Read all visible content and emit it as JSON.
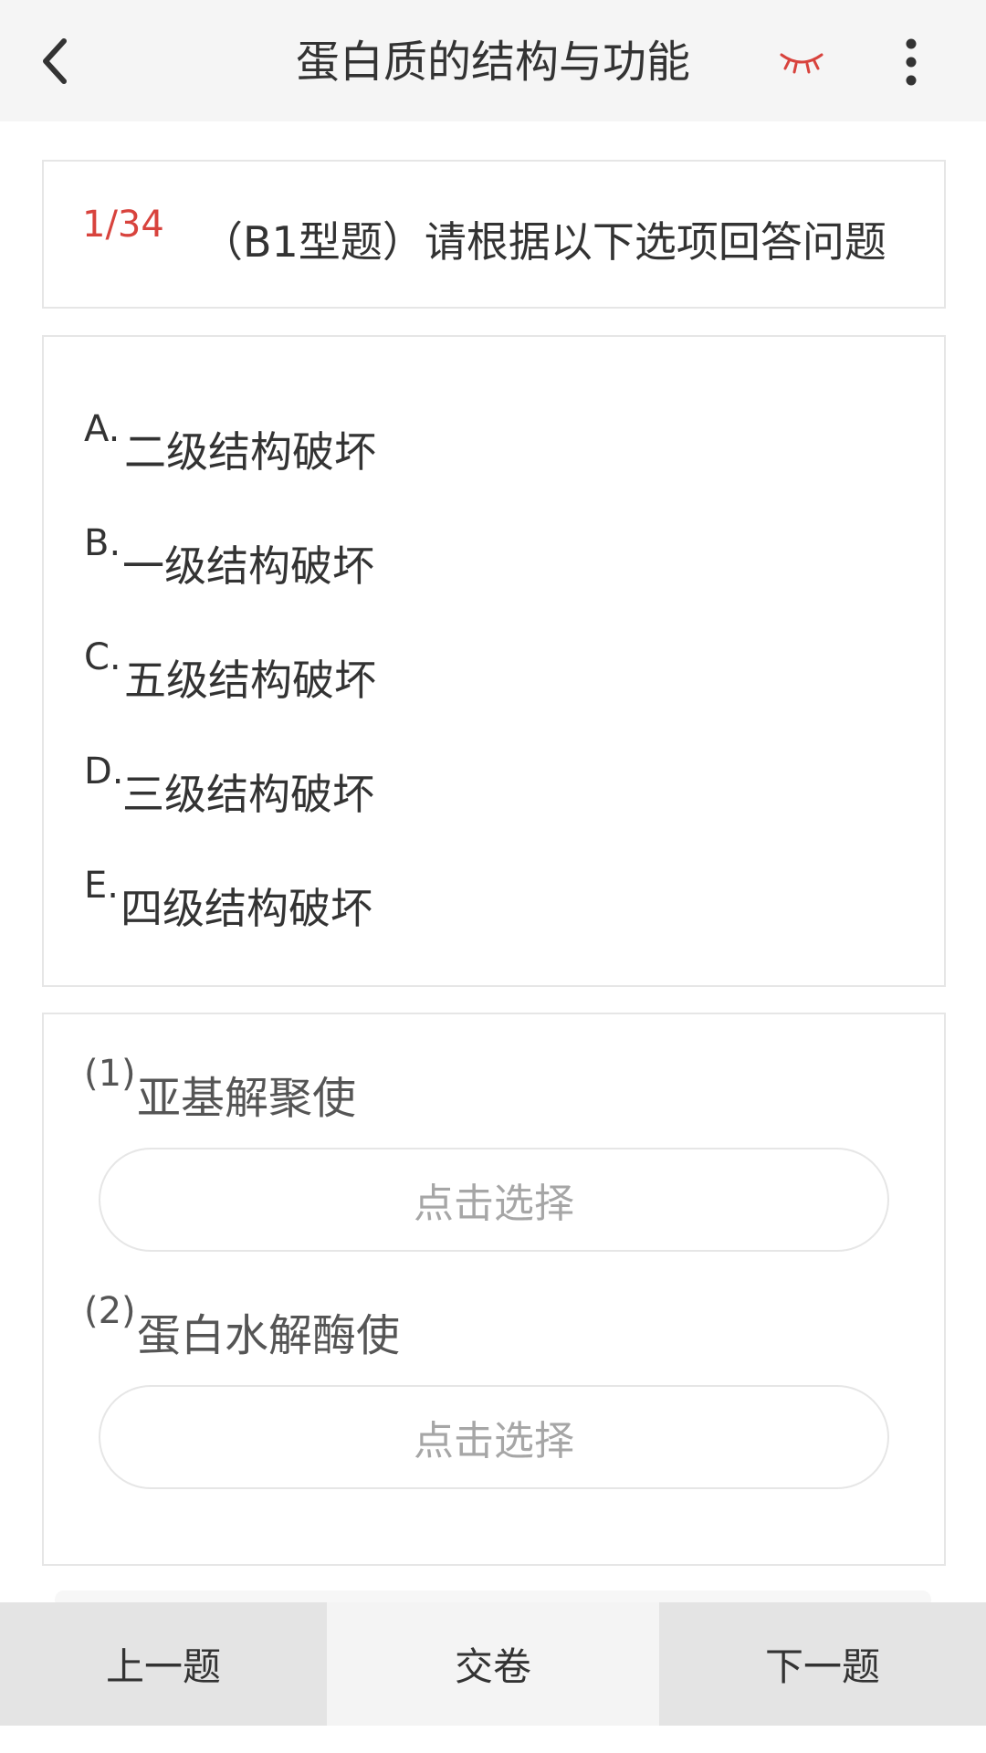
{
  "header": {
    "title": "蛋白质的结构与功能",
    "back_icon": "chevron-left-icon",
    "eye_icon": "eye-closed-icon",
    "more_icon": "more-vertical-icon",
    "eye_icon_color": "#d8433d"
  },
  "question": {
    "number": "1/34",
    "number_color": "#d8433d",
    "type_text": "（B1型题）请根据以下选项回答问题"
  },
  "options": [
    {
      "letter": "A.",
      "text": "二级结构破坏"
    },
    {
      "letter": "B.",
      "text": "一级结构破坏"
    },
    {
      "letter": "C.",
      "text": "五级结构破坏"
    },
    {
      "letter": "D.",
      "text": "三级结构破坏"
    },
    {
      "letter": "E.",
      "text": "四级结构破坏"
    }
  ],
  "sub_questions": [
    {
      "num": "(1)",
      "text": "亚基解聚使",
      "select_label": "点击选择"
    },
    {
      "num": "(2)",
      "text": "蛋白水解酶使",
      "select_label": "点击选择"
    }
  ],
  "footer": {
    "prev_label": "上一题",
    "submit_label": "交卷",
    "next_label": "下一题"
  }
}
